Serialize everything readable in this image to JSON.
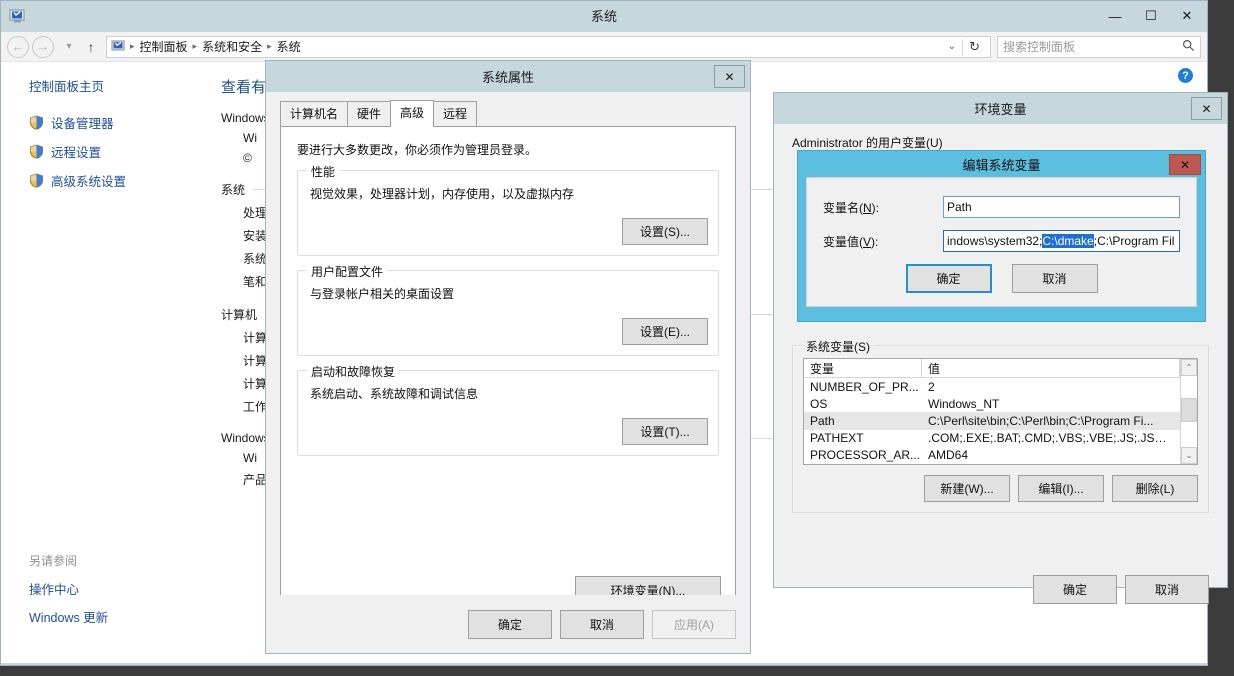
{
  "window": {
    "title": "系统",
    "icon": "computer-icon",
    "minimize": "—",
    "maximize": "☐",
    "close": "✕"
  },
  "nav": {
    "back": "←",
    "forward": "→",
    "recent": "▾",
    "up": "↑",
    "breadcrumbs": [
      "控制面板",
      "系统和安全",
      "系统"
    ],
    "dropdown_chevron": "⌄",
    "refresh": "↻"
  },
  "search": {
    "placeholder": "搜索控制面板",
    "value": "",
    "icon": "search-icon"
  },
  "sidebar": {
    "home": "控制面板主页",
    "items": [
      {
        "label": "设备管理器",
        "icon": "shield-icon"
      },
      {
        "label": "远程设置",
        "icon": "shield-icon"
      },
      {
        "label": "高级系统设置",
        "icon": "shield-icon"
      }
    ],
    "see_also_title": "另请参阅",
    "see_also": [
      "操作中心",
      "Windows 更新"
    ]
  },
  "content": {
    "heading": "查看有关计算机的基本信息",
    "windows_edition_label": "Windows 版本",
    "lines": [
      "Windows",
      "Wi",
      "©"
    ],
    "sections": [
      {
        "title": "系统",
        "rows": [
          "处理",
          "安装",
          "系统",
          "笔和"
        ]
      },
      {
        "title": "计算机",
        "rows": [
          "计算",
          "计算",
          "计算",
          "工作"
        ]
      },
      {
        "title": "Windows",
        "rows": [
          "Wi",
          "产品"
        ]
      }
    ],
    "help": "?"
  },
  "system_properties": {
    "title": "系统属性",
    "close": "✕",
    "tabs": [
      {
        "label": "计算机名",
        "active": false
      },
      {
        "label": "硬件",
        "active": false
      },
      {
        "label": "高级",
        "active": true
      },
      {
        "label": "远程",
        "active": false
      }
    ],
    "note": "要进行大多数更改，你必须作为管理员登录。",
    "groups": [
      {
        "label": "性能",
        "text": "视觉效果，处理器计划，内存使用，以及虚拟内存",
        "button": "设置(S)..."
      },
      {
        "label": "用户配置文件",
        "text": "与登录帐户相关的桌面设置",
        "button": "设置(E)..."
      },
      {
        "label": "启动和故障恢复",
        "text": "系统启动、系统故障和调试信息",
        "button": "设置(T)..."
      }
    ],
    "env_button": "环境变量(N)...",
    "ok": "确定",
    "cancel": "取消",
    "apply": "应用(A)"
  },
  "environment_variables": {
    "title": "环境变量",
    "close": "✕",
    "user_group_label": "Administrator 的用户变量(U)",
    "system_group_label": "系统变量(S)",
    "columns": [
      "变量",
      "值"
    ],
    "rows": [
      {
        "name": "NUMBER_OF_PR...",
        "value": "2",
        "selected": false
      },
      {
        "name": "OS",
        "value": "Windows_NT",
        "selected": false
      },
      {
        "name": "Path",
        "value": "C:\\Perl\\site\\bin;C:\\Perl\\bin;C:\\Program Fi...",
        "selected": true
      },
      {
        "name": "PATHEXT",
        "value": ".COM;.EXE;.BAT;.CMD;.VBS;.VBE;.JS;.JSE;....",
        "selected": false
      },
      {
        "name": "PROCESSOR_AR...",
        "value": "AMD64",
        "selected": false
      }
    ],
    "scroll_up": "⌃",
    "scroll_down": "⌄",
    "new_button": "新建(W)...",
    "edit_button": "编辑(I)...",
    "delete_button": "删除(L)",
    "ok": "确定",
    "cancel": "取消"
  },
  "edit_system_variable": {
    "title": "编辑系统变量",
    "close": "✕",
    "name_label": "变量名(N):",
    "name_value": "Path",
    "value_label": "变量值(V):",
    "value_prefix": "indows\\system32;",
    "value_selected": "C:\\dmake",
    "value_suffix": ";C:\\Program Fil",
    "ok": "确定",
    "cancel": "取消"
  },
  "colors": {
    "titlebar": "#c6d7dd",
    "active_dialog": "#5bbedf",
    "close_red": "#bc5a52",
    "link_blue": "#1f4e9c",
    "selection_blue": "#1f6fd0",
    "help_blue": "#1d7fd4"
  }
}
